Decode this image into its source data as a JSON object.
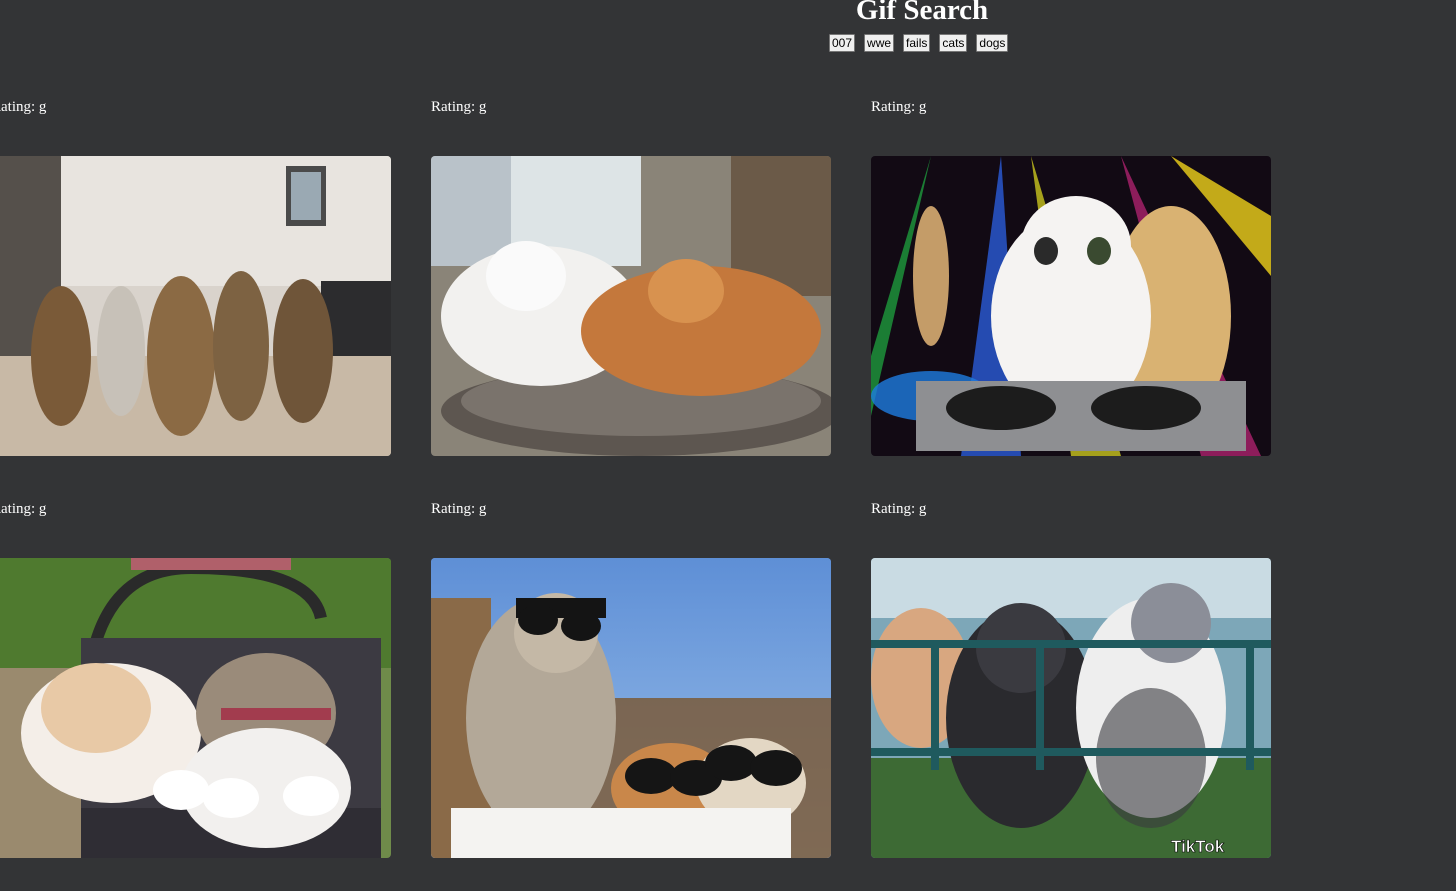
{
  "header": {
    "title": "Gif Search",
    "topics": [
      "007",
      "wwe",
      "fails",
      "cats",
      "dogs"
    ]
  },
  "gifs": [
    {
      "rating": "Rating: g",
      "subject": "five kittens looking up"
    },
    {
      "rating": "Rating: g",
      "subject": "white and orange cats cuddling in bed"
    },
    {
      "rating": "Rating: g",
      "subject": "DJ cat at turntables under disco lights"
    },
    {
      "rating": "Rating: g",
      "subject": "two cats in a pet stroller"
    },
    {
      "rating": "Rating: g",
      "subject": "cats wearing sunglasses"
    },
    {
      "rating": "Rating: g",
      "subject": "kittens dancing on a railing",
      "watermark": "TikTok"
    }
  ]
}
